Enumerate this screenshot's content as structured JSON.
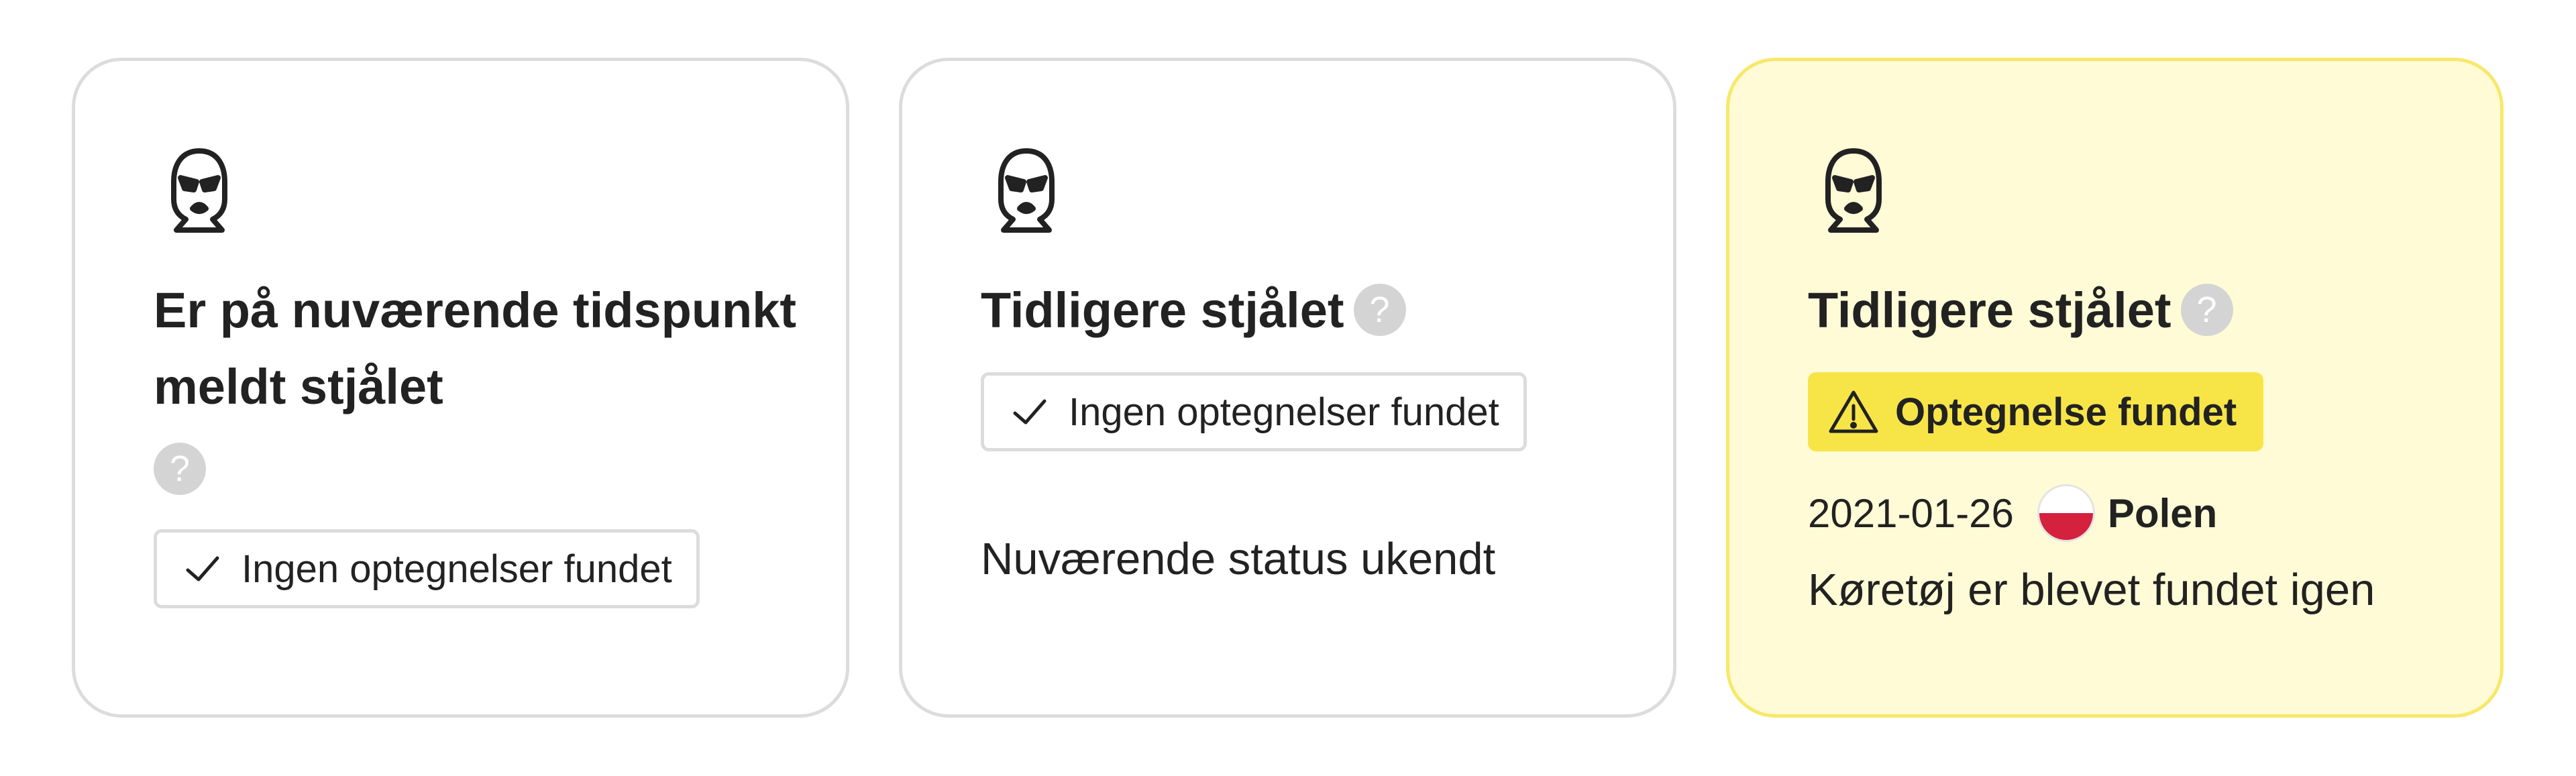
{
  "cards": [
    {
      "title": "Er på nuværende tidspunkt meldt stjålet",
      "help": "?",
      "chip": "Ingen optegnelser fundet"
    },
    {
      "title": "Tidligere stjålet",
      "help": "?",
      "chip": "Ingen optegnelser fundet",
      "status": "Nuværende status ukendt"
    },
    {
      "title": "Tidligere stjålet",
      "help": "?",
      "alert": "Optegnelse fundet",
      "date": "2021-01-26",
      "country": "Polen",
      "note": "Køretøj er blevet fundet igen"
    }
  ],
  "icons": {
    "card": "balaclava-icon",
    "help": "question-mark-icon",
    "chip": "checkmark-icon",
    "alert": "warning-triangle-icon",
    "flag": "poland-flag-icon"
  },
  "colors": {
    "border": "#dcdcdc",
    "highlight_card_bg": "#fffbd6",
    "highlight_card_border": "#f7e86a",
    "alert_bg": "#f7e548",
    "help_bg": "#d4d4d4",
    "text": "#222222"
  }
}
